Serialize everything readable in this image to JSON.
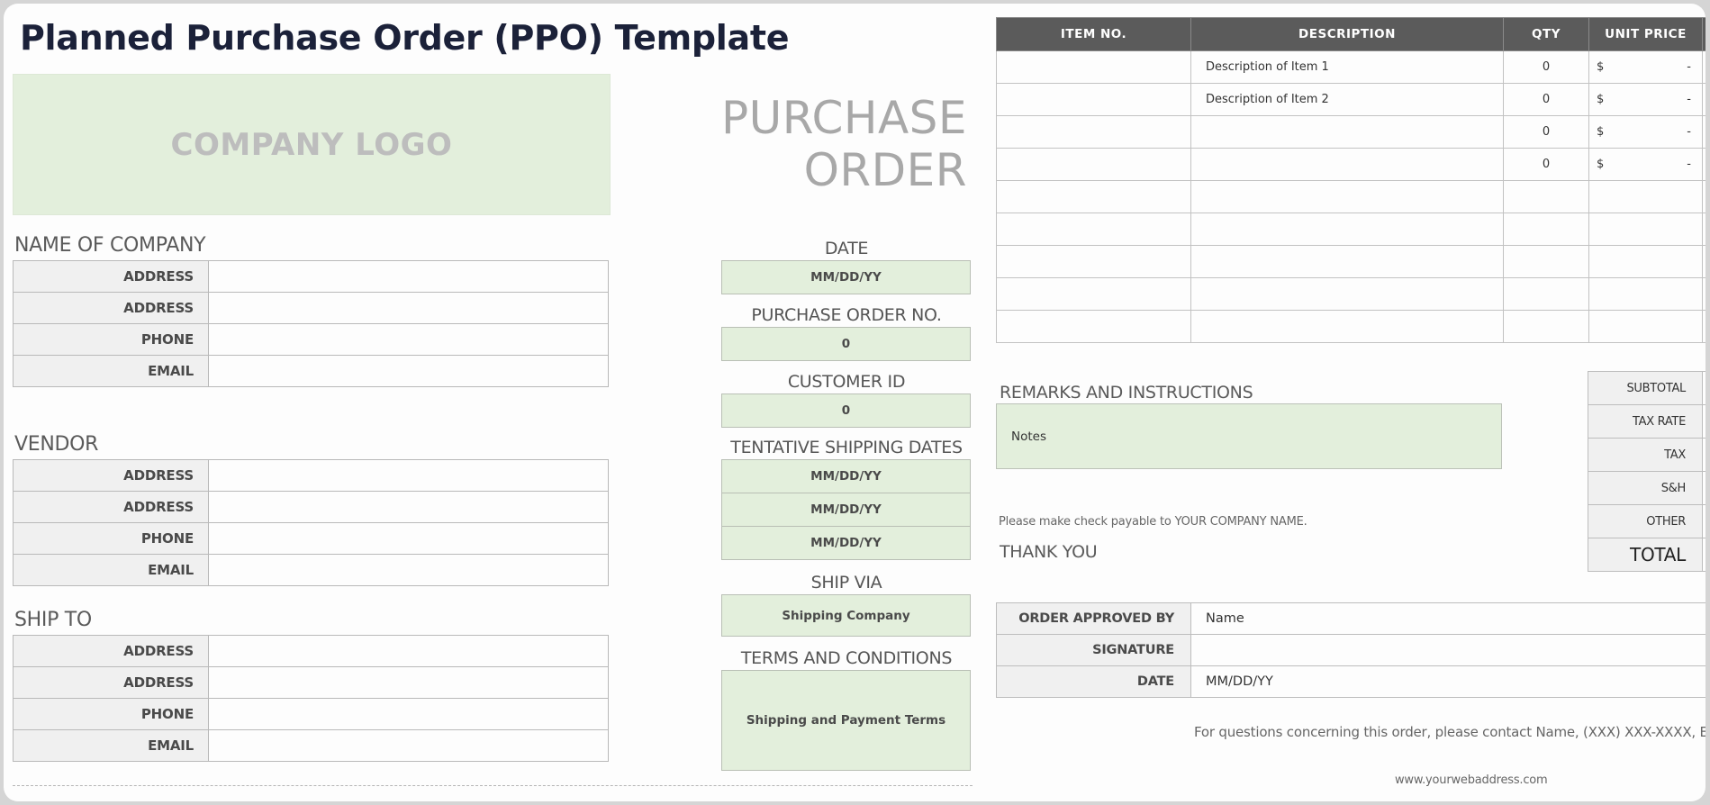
{
  "title": "Planned Purchase Order (PPO) Template",
  "logo": {
    "placeholder": "COMPANY LOGO"
  },
  "company": {
    "heading": "NAME OF COMPANY",
    "fields": [
      {
        "label": "ADDRESS",
        "value": ""
      },
      {
        "label": "ADDRESS",
        "value": ""
      },
      {
        "label": "PHONE",
        "value": ""
      },
      {
        "label": "EMAIL",
        "value": ""
      }
    ]
  },
  "vendor": {
    "heading": "VENDOR",
    "fields": [
      {
        "label": "ADDRESS",
        "value": ""
      },
      {
        "label": "ADDRESS",
        "value": ""
      },
      {
        "label": "PHONE",
        "value": ""
      },
      {
        "label": "EMAIL",
        "value": ""
      }
    ]
  },
  "ship_to": {
    "heading": "SHIP TO",
    "fields": [
      {
        "label": "ADDRESS",
        "value": ""
      },
      {
        "label": "ADDRESS",
        "value": ""
      },
      {
        "label": "PHONE",
        "value": ""
      },
      {
        "label": "EMAIL",
        "value": ""
      }
    ]
  },
  "document_heading": {
    "line1": "PURCHASE",
    "line2": "ORDER"
  },
  "order_info": {
    "date": {
      "label": "DATE",
      "value": "MM/DD/YY"
    },
    "po_number": {
      "label": "PURCHASE ORDER NO.",
      "value": "0"
    },
    "customer_id": {
      "label": "CUSTOMER ID",
      "value": "0"
    },
    "shipping_dates": {
      "label": "TENTATIVE SHIPPING DATES",
      "values": [
        "MM/DD/YY",
        "MM/DD/YY",
        "MM/DD/YY"
      ]
    },
    "ship_via": {
      "label": "SHIP VIA",
      "value": "Shipping Company"
    },
    "terms": {
      "label": "TERMS AND CONDITIONS",
      "value": "Shipping and Payment Terms"
    }
  },
  "items": {
    "columns": [
      "ITEM NO.",
      "DESCRIPTION",
      "QTY",
      "UNIT PRICE",
      ""
    ],
    "rows": [
      {
        "item_no": "",
        "description": "Description of Item 1",
        "qty": "0",
        "currency": "$",
        "unit_price": "-",
        "total": ""
      },
      {
        "item_no": "",
        "description": "Description of Item 2",
        "qty": "0",
        "currency": "$",
        "unit_price": "-",
        "total": ""
      },
      {
        "item_no": "",
        "description": "",
        "qty": "0",
        "currency": "$",
        "unit_price": "-",
        "total": ""
      },
      {
        "item_no": "",
        "description": "",
        "qty": "0",
        "currency": "$",
        "unit_price": "-",
        "total": ""
      },
      {
        "item_no": "",
        "description": "",
        "qty": "",
        "currency": "",
        "unit_price": "",
        "total": ""
      },
      {
        "item_no": "",
        "description": "",
        "qty": "",
        "currency": "",
        "unit_price": "",
        "total": ""
      },
      {
        "item_no": "",
        "description": "",
        "qty": "",
        "currency": "",
        "unit_price": "",
        "total": ""
      },
      {
        "item_no": "",
        "description": "",
        "qty": "",
        "currency": "",
        "unit_price": "",
        "total": ""
      },
      {
        "item_no": "",
        "description": "",
        "qty": "",
        "currency": "",
        "unit_price": "",
        "total": ""
      }
    ]
  },
  "remarks": {
    "heading": "REMARKS AND INSTRUCTIONS",
    "value": "Notes"
  },
  "payable_note": "Please make check payable to YOUR COMPANY NAME.",
  "thank_you": "THANK YOU",
  "totals": [
    {
      "label": "SUBTOTAL",
      "value": ""
    },
    {
      "label": "TAX RATE",
      "value": ""
    },
    {
      "label": "TAX",
      "value": ""
    },
    {
      "label": "S&H",
      "value": ""
    },
    {
      "label": "OTHER",
      "value": ""
    },
    {
      "label": "TOTAL",
      "value": ""
    }
  ],
  "approval": [
    {
      "label": "ORDER APPROVED BY",
      "value": "Name"
    },
    {
      "label": "SIGNATURE",
      "value": ""
    },
    {
      "label": "DATE",
      "value": "MM/DD/YY"
    }
  ],
  "contact_note": "For questions concerning this order, please contact Name, (XXX) XXX-XXXX, Email A",
  "website": "www.yourwebaddress.com",
  "colors": {
    "header_fill": "#5b5b5b",
    "input_green": "#e3efdc",
    "title": "#1b2139"
  }
}
